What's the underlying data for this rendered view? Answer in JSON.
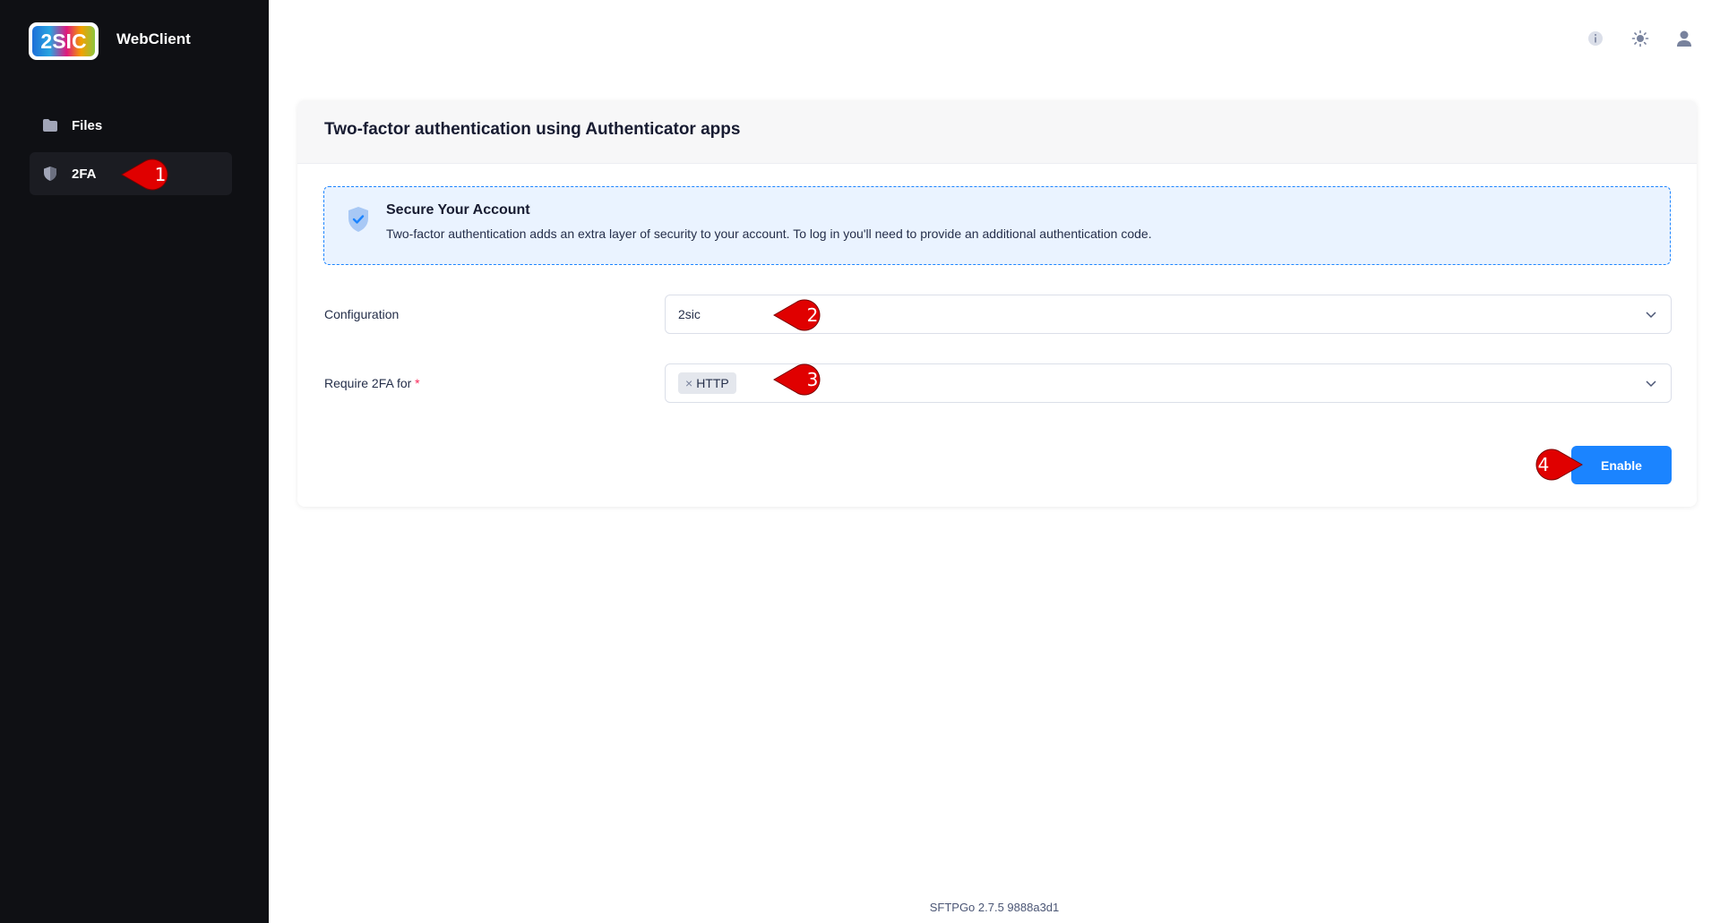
{
  "app": {
    "title": "WebClient",
    "logo_text": "2SIC"
  },
  "sidebar": {
    "items": [
      {
        "label": "Files",
        "icon": "folder-icon"
      },
      {
        "label": "2FA",
        "icon": "shield-icon",
        "active": true
      }
    ]
  },
  "topbar": {
    "icons": [
      "info-icon",
      "theme-sun-icon",
      "user-icon"
    ]
  },
  "card": {
    "title": "Two-factor authentication using Authenticator apps",
    "notice": {
      "title": "Secure Your Account",
      "text": "Two-factor authentication adds an extra layer of security to your account. To log in you'll need to provide an additional authentication code."
    },
    "configuration": {
      "label": "Configuration",
      "value": "2sic"
    },
    "require": {
      "label": "Require 2FA for",
      "required_mark": "*",
      "tags": [
        "HTTP"
      ],
      "tag_remove": "×"
    },
    "enable_label": "Enable"
  },
  "callouts": [
    "1",
    "2",
    "3",
    "4"
  ],
  "footer": {
    "version": "SFTPGo 2.7.5 9888a3d1"
  },
  "colors": {
    "sidebar_bg": "#0f1014",
    "accent": "#1b84ff",
    "callout": "#e00000",
    "notice_bg": "#eaf3ff"
  }
}
